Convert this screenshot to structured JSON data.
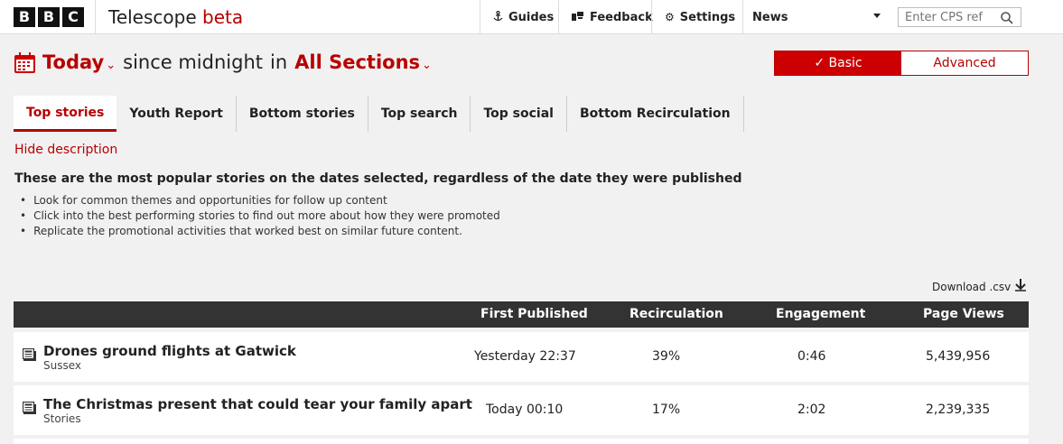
{
  "header": {
    "logo_letters": [
      "B",
      "B",
      "C"
    ],
    "app_name": "Telescope",
    "app_badge": "beta",
    "nav": [
      {
        "label": "Guides",
        "icon": "anchor-icon"
      },
      {
        "label": "Feedback",
        "icon": "flag-icon"
      },
      {
        "label": "Settings",
        "icon": "gear-icon"
      }
    ],
    "site_select": "News",
    "search_placeholder": "Enter CPS ref"
  },
  "filters": {
    "period": "Today",
    "since_text": "since midnight",
    "in_text": "in",
    "section": "All Sections"
  },
  "mode_toggle": {
    "basic_label": "✓ Basic",
    "advanced_label": "Advanced",
    "selected": "Basic"
  },
  "tabs": [
    {
      "label": "Top stories",
      "active": true
    },
    {
      "label": "Youth Report",
      "active": false
    },
    {
      "label": "Bottom stories",
      "active": false
    },
    {
      "label": "Top search",
      "active": false
    },
    {
      "label": "Top social",
      "active": false
    },
    {
      "label": "Bottom Recirculation",
      "active": false
    }
  ],
  "description": {
    "toggle_label": "Hide description",
    "title": "These are the most popular stories on the dates selected, regardless of the date they were published",
    "bullets": [
      "Look for common themes and opportunities for follow up content",
      "Click into the best performing stories to find out more about how they were promoted",
      "Replicate the promotional activities that worked best on similar future content."
    ]
  },
  "download_label": "Download .csv",
  "table": {
    "columns": [
      "First Published",
      "Recirculation",
      "Engagement",
      "Page Views"
    ],
    "rows": [
      {
        "title": "Drones ground flights at Gatwick",
        "section": "Sussex",
        "first_published": "Yesterday 22:37",
        "recirculation": "39%",
        "engagement": "0:46",
        "page_views": "5,439,956"
      },
      {
        "title": "The Christmas present that could tear your family apart",
        "section": "Stories",
        "first_published": "Today 00:10",
        "recirculation": "17%",
        "engagement": "2:02",
        "page_views": "2,239,335"
      }
    ]
  },
  "colors": {
    "brand_red": "#b80000",
    "toggle_red": "#cc0000",
    "table_header": "#333333",
    "page_bg": "#f1f1f1"
  }
}
